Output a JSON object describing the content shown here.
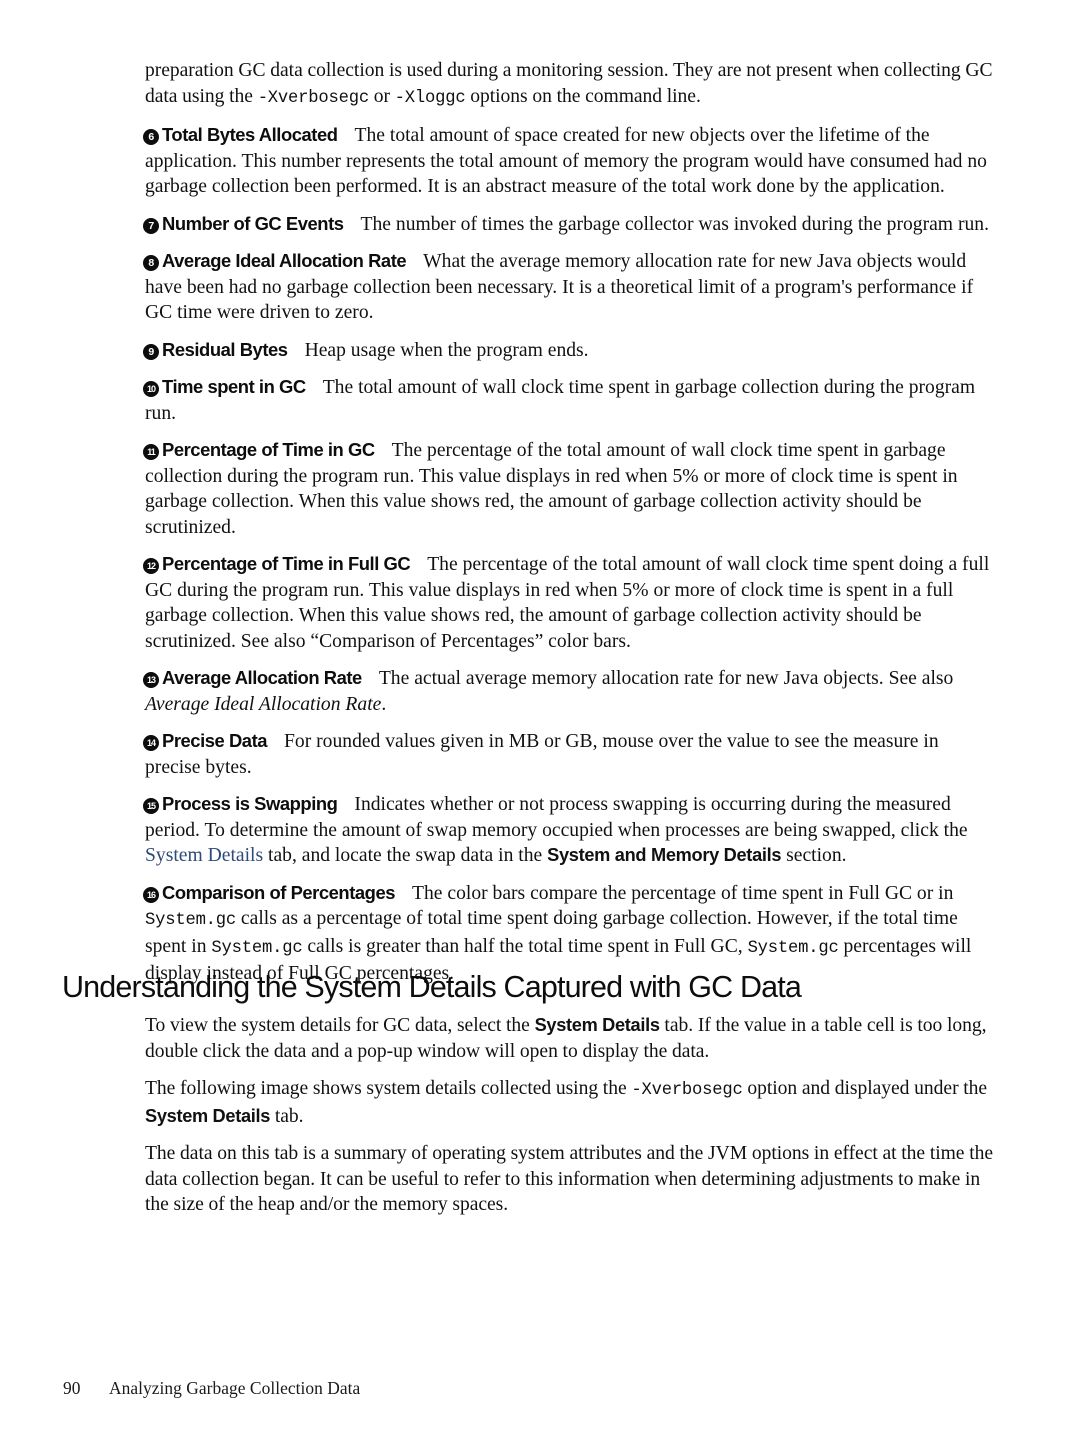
{
  "page": {
    "background": "#ffffff",
    "link_color": "#2d4a78",
    "text_color": "#111111"
  },
  "intro": {
    "part1": "preparation GC data collection is used during a monitoring session. They are not present when collecting GC data using the ",
    "code1": "-Xverbosegc",
    "part2": " or ",
    "code2": "-Xloggc",
    "part3": " options on the command line."
  },
  "callouts": [
    {
      "number": "6",
      "term": "Total Bytes Allocated",
      "text": "The total amount of space created for new objects over the lifetime of the application. This number represents the total amount of memory the program would have consumed had no garbage collection been performed. It is an abstract measure of the total work done by the application."
    },
    {
      "number": "7",
      "term": "Number of GC Events",
      "text": "The number of times the garbage collector was invoked during the program run."
    },
    {
      "number": "8",
      "term": "Average Ideal Allocation Rate",
      "text": "What the average memory allocation rate for new Java objects would have been had no garbage collection been necessary. It is a theoretical limit of a program's performance if GC time were driven to zero."
    },
    {
      "number": "9",
      "term": "Residual Bytes",
      "text": "Heap usage when the program ends."
    },
    {
      "number": "10",
      "term": "Time spent in GC",
      "text": "The total amount of wall clock time spent in garbage collection during the program run."
    },
    {
      "number": "11",
      "term": "Percentage of Time in GC",
      "text": "The percentage of the total amount of wall clock time spent in garbage collection during the program run. This value displays in red when 5% or more of clock time is spent in garbage collection. When this value shows red, the amount of garbage collection activity should be scrutinized."
    },
    {
      "number": "12",
      "term": "Percentage of Time in Full GC",
      "text": "The percentage of the total amount of wall clock time spent doing a full GC during the program run. This value displays in red when 5% or more of clock time is spent in a full garbage collection. When this value shows red, the amount of garbage collection activity should be scrutinized. See also “Comparison of Percentages” color bars."
    }
  ],
  "callout_13": {
    "number": "13",
    "term": "Average Allocation Rate",
    "text_before": "The actual average memory allocation rate for new Java objects. See also ",
    "italic": "Average Ideal Allocation Rate",
    "text_after": "."
  },
  "callout_14": {
    "number": "14",
    "term": "Precise Data",
    "text": "For rounded values given in MB or GB, mouse over the value to see the measure in precise bytes."
  },
  "callout_15": {
    "number": "15",
    "term": "Process is Swapping",
    "text_1": "Indicates whether or not process swapping is occurring during the measured period. To determine the amount of swap memory occupied when processes are being swapped, click the ",
    "link": "System Details",
    "text_2": " tab, and locate the swap data in the ",
    "bold": "System and Memory Details",
    "text_3": " section."
  },
  "callout_16": {
    "number": "16",
    "term": "Comparison of Percentages",
    "text_1": "The color bars compare the percentage of time spent in Full GC or in ",
    "code_1": "System.gc",
    "text_2": " calls as a percentage of total time spent doing garbage collection. However, if the total time spent in ",
    "code_2": "System.gc",
    "text_3": " calls is greater than half the total time spent in Full GC, ",
    "code_3": "System.gc",
    "text_4": " percentages will display instead of Full GC percentages."
  },
  "heading": "Understanding the System Details Captured with GC Data",
  "after_heading": {
    "p1_before": "To view the system details for GC data, select the ",
    "p1_bold": "System Details",
    "p1_after": " tab. If the value in a table cell is too long, double click the data and a pop-up window will open to display the data.",
    "p2_before": "The following image shows system details collected using the ",
    "p2_code": "-Xverbosegc",
    "p2_mid": " option and displayed under the ",
    "p2_bold": "System Details",
    "p2_after": " tab.",
    "p3": "The data on this tab is a summary of operating system attributes and the JVM options in effect at the time the data collection began. It can be useful to refer to this information when determining adjustments to make in the size of the heap and/or the memory spaces."
  },
  "footer": {
    "page_number": "90",
    "chapter_title": "Analyzing Garbage Collection Data"
  }
}
